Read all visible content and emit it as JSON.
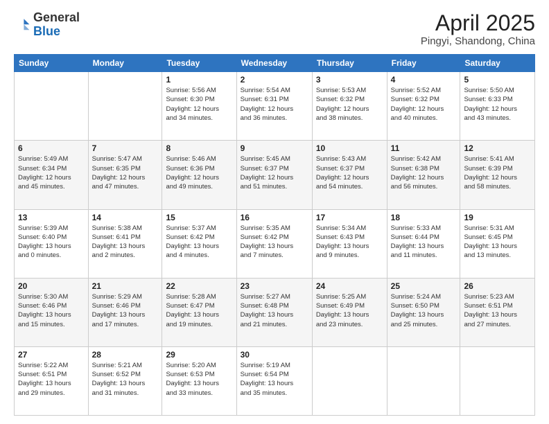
{
  "header": {
    "logo_general": "General",
    "logo_blue": "Blue",
    "main_title": "April 2025",
    "subtitle": "Pingyi, Shandong, China"
  },
  "days_of_week": [
    "Sunday",
    "Monday",
    "Tuesday",
    "Wednesday",
    "Thursday",
    "Friday",
    "Saturday"
  ],
  "weeks": [
    {
      "shade": "white",
      "days": [
        {
          "num": "",
          "info": ""
        },
        {
          "num": "",
          "info": ""
        },
        {
          "num": "1",
          "info": "Sunrise: 5:56 AM\nSunset: 6:30 PM\nDaylight: 12 hours\nand 34 minutes."
        },
        {
          "num": "2",
          "info": "Sunrise: 5:54 AM\nSunset: 6:31 PM\nDaylight: 12 hours\nand 36 minutes."
        },
        {
          "num": "3",
          "info": "Sunrise: 5:53 AM\nSunset: 6:32 PM\nDaylight: 12 hours\nand 38 minutes."
        },
        {
          "num": "4",
          "info": "Sunrise: 5:52 AM\nSunset: 6:32 PM\nDaylight: 12 hours\nand 40 minutes."
        },
        {
          "num": "5",
          "info": "Sunrise: 5:50 AM\nSunset: 6:33 PM\nDaylight: 12 hours\nand 43 minutes."
        }
      ]
    },
    {
      "shade": "shade",
      "days": [
        {
          "num": "6",
          "info": "Sunrise: 5:49 AM\nSunset: 6:34 PM\nDaylight: 12 hours\nand 45 minutes."
        },
        {
          "num": "7",
          "info": "Sunrise: 5:47 AM\nSunset: 6:35 PM\nDaylight: 12 hours\nand 47 minutes."
        },
        {
          "num": "8",
          "info": "Sunrise: 5:46 AM\nSunset: 6:36 PM\nDaylight: 12 hours\nand 49 minutes."
        },
        {
          "num": "9",
          "info": "Sunrise: 5:45 AM\nSunset: 6:37 PM\nDaylight: 12 hours\nand 51 minutes."
        },
        {
          "num": "10",
          "info": "Sunrise: 5:43 AM\nSunset: 6:37 PM\nDaylight: 12 hours\nand 54 minutes."
        },
        {
          "num": "11",
          "info": "Sunrise: 5:42 AM\nSunset: 6:38 PM\nDaylight: 12 hours\nand 56 minutes."
        },
        {
          "num": "12",
          "info": "Sunrise: 5:41 AM\nSunset: 6:39 PM\nDaylight: 12 hours\nand 58 minutes."
        }
      ]
    },
    {
      "shade": "white",
      "days": [
        {
          "num": "13",
          "info": "Sunrise: 5:39 AM\nSunset: 6:40 PM\nDaylight: 13 hours\nand 0 minutes."
        },
        {
          "num": "14",
          "info": "Sunrise: 5:38 AM\nSunset: 6:41 PM\nDaylight: 13 hours\nand 2 minutes."
        },
        {
          "num": "15",
          "info": "Sunrise: 5:37 AM\nSunset: 6:42 PM\nDaylight: 13 hours\nand 4 minutes."
        },
        {
          "num": "16",
          "info": "Sunrise: 5:35 AM\nSunset: 6:42 PM\nDaylight: 13 hours\nand 7 minutes."
        },
        {
          "num": "17",
          "info": "Sunrise: 5:34 AM\nSunset: 6:43 PM\nDaylight: 13 hours\nand 9 minutes."
        },
        {
          "num": "18",
          "info": "Sunrise: 5:33 AM\nSunset: 6:44 PM\nDaylight: 13 hours\nand 11 minutes."
        },
        {
          "num": "19",
          "info": "Sunrise: 5:31 AM\nSunset: 6:45 PM\nDaylight: 13 hours\nand 13 minutes."
        }
      ]
    },
    {
      "shade": "shade",
      "days": [
        {
          "num": "20",
          "info": "Sunrise: 5:30 AM\nSunset: 6:46 PM\nDaylight: 13 hours\nand 15 minutes."
        },
        {
          "num": "21",
          "info": "Sunrise: 5:29 AM\nSunset: 6:46 PM\nDaylight: 13 hours\nand 17 minutes."
        },
        {
          "num": "22",
          "info": "Sunrise: 5:28 AM\nSunset: 6:47 PM\nDaylight: 13 hours\nand 19 minutes."
        },
        {
          "num": "23",
          "info": "Sunrise: 5:27 AM\nSunset: 6:48 PM\nDaylight: 13 hours\nand 21 minutes."
        },
        {
          "num": "24",
          "info": "Sunrise: 5:25 AM\nSunset: 6:49 PM\nDaylight: 13 hours\nand 23 minutes."
        },
        {
          "num": "25",
          "info": "Sunrise: 5:24 AM\nSunset: 6:50 PM\nDaylight: 13 hours\nand 25 minutes."
        },
        {
          "num": "26",
          "info": "Sunrise: 5:23 AM\nSunset: 6:51 PM\nDaylight: 13 hours\nand 27 minutes."
        }
      ]
    },
    {
      "shade": "white",
      "days": [
        {
          "num": "27",
          "info": "Sunrise: 5:22 AM\nSunset: 6:51 PM\nDaylight: 13 hours\nand 29 minutes."
        },
        {
          "num": "28",
          "info": "Sunrise: 5:21 AM\nSunset: 6:52 PM\nDaylight: 13 hours\nand 31 minutes."
        },
        {
          "num": "29",
          "info": "Sunrise: 5:20 AM\nSunset: 6:53 PM\nDaylight: 13 hours\nand 33 minutes."
        },
        {
          "num": "30",
          "info": "Sunrise: 5:19 AM\nSunset: 6:54 PM\nDaylight: 13 hours\nand 35 minutes."
        },
        {
          "num": "",
          "info": ""
        },
        {
          "num": "",
          "info": ""
        },
        {
          "num": "",
          "info": ""
        }
      ]
    }
  ]
}
